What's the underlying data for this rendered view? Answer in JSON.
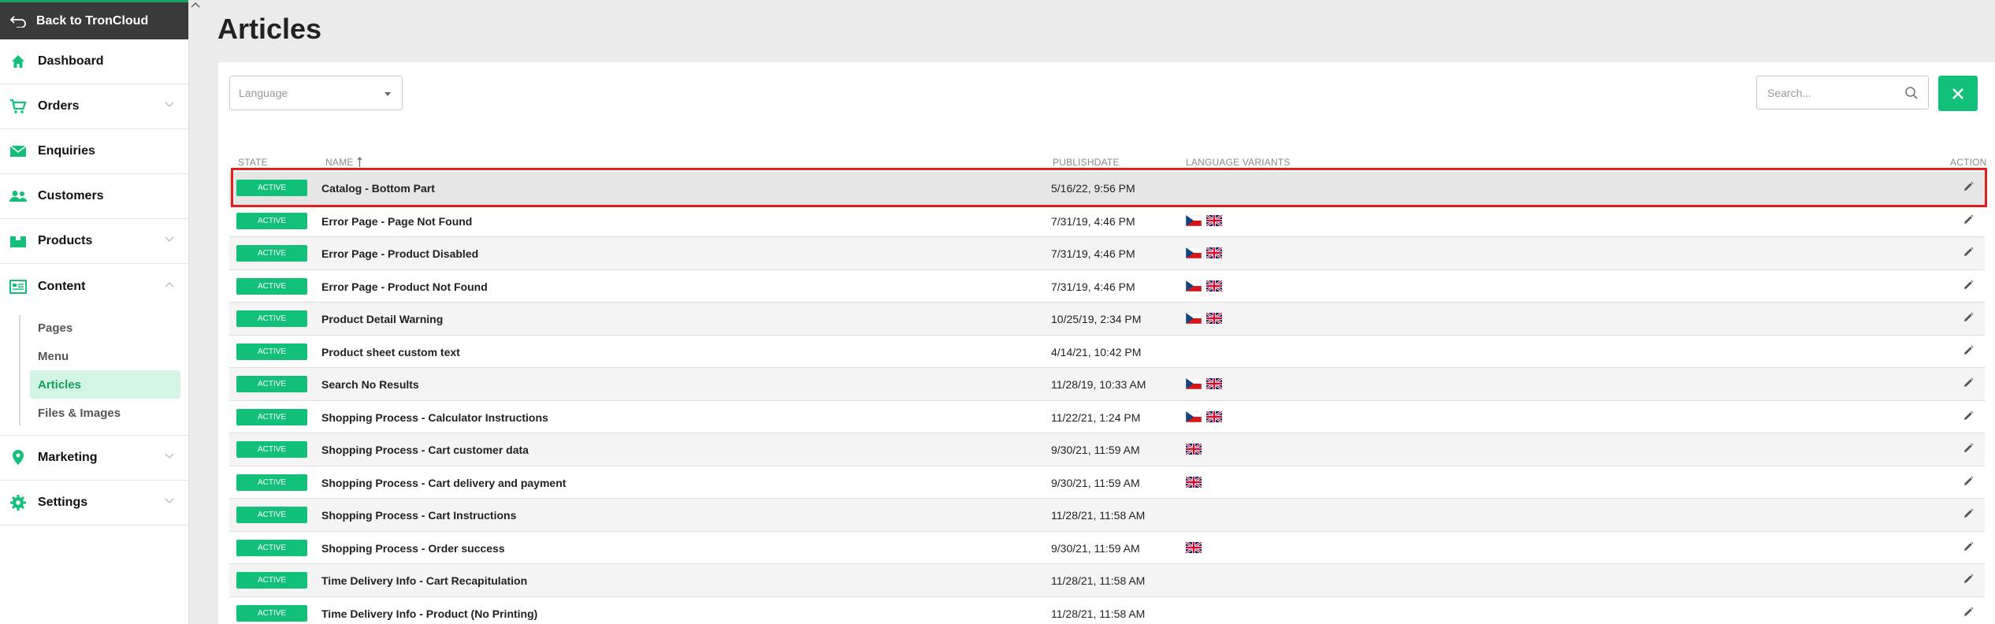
{
  "sidebar": {
    "back_label": "Back to TronCloud",
    "items": [
      {
        "label": "Dashboard",
        "icon": "home-icon"
      },
      {
        "label": "Orders",
        "icon": "cart-icon"
      },
      {
        "label": "Enquiries",
        "icon": "mail-icon"
      },
      {
        "label": "Customers",
        "icon": "users-icon"
      },
      {
        "label": "Products",
        "icon": "box-icon"
      },
      {
        "label": "Content",
        "icon": "content-icon"
      },
      {
        "label": "Marketing",
        "icon": "pin-icon"
      },
      {
        "label": "Settings",
        "icon": "gear-icon"
      }
    ],
    "content_sub": [
      "Pages",
      "Menu",
      "Articles",
      "Files & Images"
    ]
  },
  "page": {
    "title": "Articles"
  },
  "filters": {
    "language_placeholder": "Language",
    "search_placeholder": "Search..."
  },
  "table": {
    "headers": {
      "state": "STATE",
      "name": "NAME",
      "publishdate": "PUBLISHDATE",
      "language_variants": "LANGUAGE VARIANTS",
      "action": "ACTION"
    },
    "rows": [
      {
        "state": "ACTIVE",
        "name": "Catalog - Bottom Part",
        "date": "5/16/22, 9:56 PM",
        "flags": []
      },
      {
        "state": "ACTIVE",
        "name": "Error Page - Page Not Found",
        "date": "7/31/19, 4:46 PM",
        "flags": [
          "cz",
          "gb"
        ]
      },
      {
        "state": "ACTIVE",
        "name": "Error Page - Product Disabled",
        "date": "7/31/19, 4:46 PM",
        "flags": [
          "cz",
          "gb"
        ]
      },
      {
        "state": "ACTIVE",
        "name": "Error Page - Product Not Found",
        "date": "7/31/19, 4:46 PM",
        "flags": [
          "cz",
          "gb"
        ]
      },
      {
        "state": "ACTIVE",
        "name": "Product Detail Warning",
        "date": "10/25/19, 2:34 PM",
        "flags": [
          "cz",
          "gb"
        ]
      },
      {
        "state": "ACTIVE",
        "name": "Product sheet custom text",
        "date": "4/14/21, 10:42 PM",
        "flags": []
      },
      {
        "state": "ACTIVE",
        "name": "Search No Results",
        "date": "11/28/19, 10:33 AM",
        "flags": [
          "cz",
          "gb"
        ]
      },
      {
        "state": "ACTIVE",
        "name": "Shopping Process - Calculator Instructions",
        "date": "11/22/21, 1:24 PM",
        "flags": [
          "cz",
          "gb"
        ]
      },
      {
        "state": "ACTIVE",
        "name": "Shopping Process - Cart customer data",
        "date": "9/30/21, 11:59 AM",
        "flags": [
          "gb"
        ]
      },
      {
        "state": "ACTIVE",
        "name": "Shopping Process - Cart delivery and payment",
        "date": "9/30/21, 11:59 AM",
        "flags": [
          "gb"
        ]
      },
      {
        "state": "ACTIVE",
        "name": "Shopping Process - Cart Instructions",
        "date": "11/28/21, 11:58 AM",
        "flags": []
      },
      {
        "state": "ACTIVE",
        "name": "Shopping Process - Order success",
        "date": "9/30/21, 11:59 AM",
        "flags": [
          "gb"
        ]
      },
      {
        "state": "ACTIVE",
        "name": "Time Delivery Info - Cart Recapitulation",
        "date": "11/28/21, 11:58 AM",
        "flags": []
      },
      {
        "state": "ACTIVE",
        "name": "Time Delivery Info - Product (No Printing)",
        "date": "11/28/21, 11:58 AM",
        "flags": []
      }
    ]
  },
  "colors": {
    "accent": "#12c07a",
    "highlight": "#e01f1f",
    "active_sub_bg": "#d4f5e6"
  }
}
